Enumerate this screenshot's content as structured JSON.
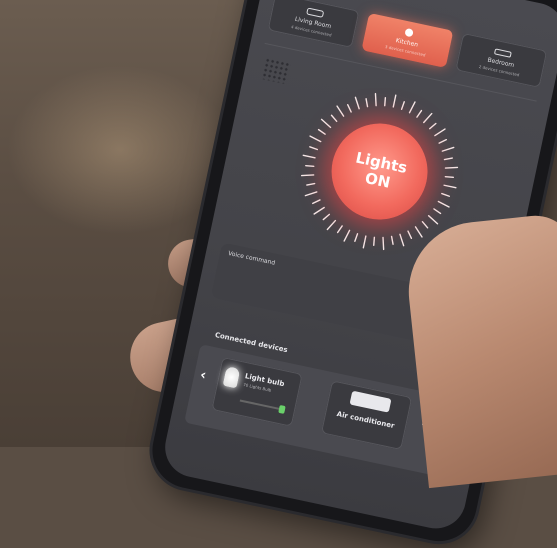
{
  "rooms": [
    {
      "label": "Living Room",
      "sub": "4 devices connected",
      "active": false,
      "icon": "sofa-icon"
    },
    {
      "label": "Kitchen",
      "sub": "3 devices connected",
      "active": true,
      "icon": "kitchen-icon"
    },
    {
      "label": "Bedroom",
      "sub": "2 devices connected",
      "active": false,
      "icon": "bed-icon"
    }
  ],
  "main_button": {
    "line1": "Lights",
    "line2": "ON"
  },
  "voice": {
    "label": "Voice command"
  },
  "devices": {
    "title": "Connected devices",
    "items": [
      {
        "name": "Light bulb",
        "sub": "70 Lights Bulb",
        "icon": "light-bulb-icon",
        "level": 1.0
      },
      {
        "name": "Air conditioner",
        "icon": "air-conditioner-icon"
      }
    ]
  },
  "colors": {
    "accent": "#f26a5e",
    "glow": "#ff4646",
    "screen": "#444449",
    "slider_on": "#6ad06a"
  }
}
